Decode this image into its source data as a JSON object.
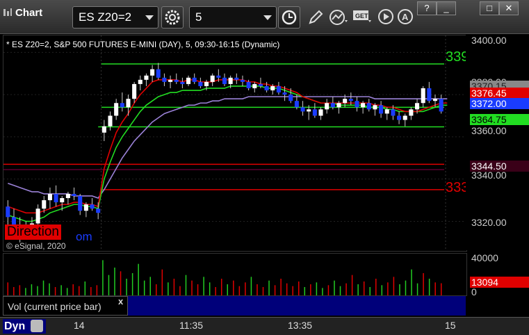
{
  "toolbar": {
    "tab_label": "Chart",
    "symbol_value": "ES Z20=2",
    "interval_value": "5",
    "colors": {
      "bg": "#2d2d2d",
      "accent": "#ffffff"
    }
  },
  "window_buttons": [
    "?",
    "_",
    "□",
    "✕"
  ],
  "chart": {
    "title": "* ES Z20=2, S&P 500 FUTURES E-MINI (DAY), 5, 09:30-16:15 (Dynamic)",
    "direction_label": "Direction",
    "direction_suffix": "om",
    "copyright": "© eSignal, 2020",
    "level_labels": {
      "upper_green": "339",
      "red_line": "333"
    },
    "y_ticks": [
      "3400.00",
      "3380.00",
      "3360.00",
      "3340.00",
      "3320.00"
    ],
    "price_tags": [
      {
        "label": "3370.15",
        "color": "#888888",
        "text_color": "#222"
      },
      {
        "label": "3376.45",
        "color": "#e00000",
        "text_color": "#fff"
      },
      {
        "label": "3372.00",
        "color": "#1a3cff",
        "text_color": "#fff"
      },
      {
        "label": "3364.75",
        "color": "#22dd22",
        "text_color": "#000"
      },
      {
        "label": "3344.50",
        "color": "#3a0018",
        "text_color": "#fff"
      }
    ],
    "x_ticks": [
      "14",
      "11:35",
      "13:35",
      "15"
    ]
  },
  "volume": {
    "y_ticks": [
      "40000",
      "0"
    ],
    "current_tag": "13094",
    "label": "Vol (current price bar)",
    "close_glyph": "x"
  },
  "bottom": {
    "dyn_label": "Dyn"
  },
  "chart_data": {
    "type": "line",
    "ylim": [
      3306,
      3408
    ],
    "hlines": [
      {
        "value": 3394.5,
        "color": "#22dd22"
      },
      {
        "value": 3374.0,
        "color": "#22dd22"
      },
      {
        "value": 3364.75,
        "color": "#22dd22"
      },
      {
        "value": 3347.0,
        "color": "#e00000"
      },
      {
        "value": 3344.5,
        "color": "#5a0030"
      },
      {
        "value": 3335.0,
        "color": "#e00000"
      }
    ],
    "bars": [
      [
        3327,
        3330,
        3316,
        3322
      ],
      [
        3322,
        3326,
        3312,
        3318
      ],
      [
        3318,
        3322,
        3310,
        3314
      ],
      [
        3314,
        3320,
        3312,
        3318
      ],
      [
        3318,
        3322,
        3316,
        3319
      ],
      [
        3319,
        3328,
        3318,
        3326
      ],
      [
        3326,
        3332,
        3324,
        3330
      ],
      [
        3330,
        3336,
        3326,
        3333
      ],
      [
        3333,
        3337,
        3327,
        3329
      ],
      [
        3329,
        3332,
        3325,
        3331
      ],
      [
        3331,
        3334,
        3328,
        3333
      ],
      [
        3333,
        3336,
        3330,
        3332
      ],
      [
        3332,
        3333,
        3323,
        3325
      ],
      [
        3325,
        3329,
        3322,
        3328
      ],
      [
        3328,
        3331,
        3325,
        3326
      ],
      [
        3326,
        3329,
        3321,
        3324
      ],
      [
        3362,
        3368,
        3358,
        3365
      ],
      [
        3365,
        3372,
        3363,
        3370
      ],
      [
        3370,
        3378,
        3368,
        3376
      ],
      [
        3376,
        3381,
        3372,
        3374
      ],
      [
        3374,
        3380,
        3370,
        3378
      ],
      [
        3378,
        3386,
        3376,
        3385
      ],
      [
        3385,
        3389,
        3382,
        3387
      ],
      [
        3387,
        3390,
        3384,
        3389
      ],
      [
        3389,
        3394,
        3386,
        3392
      ],
      [
        3392,
        3395,
        3387,
        3388
      ],
      [
        3388,
        3390,
        3384,
        3386
      ],
      [
        3386,
        3389,
        3383,
        3387
      ],
      [
        3387,
        3390,
        3385,
        3386
      ],
      [
        3386,
        3388,
        3383,
        3385
      ],
      [
        3385,
        3389,
        3384,
        3388
      ],
      [
        3388,
        3390,
        3385,
        3386
      ],
      [
        3386,
        3388,
        3383,
        3384
      ],
      [
        3384,
        3387,
        3382,
        3386
      ],
      [
        3386,
        3390,
        3384,
        3389
      ],
      [
        3389,
        3392,
        3386,
        3388
      ],
      [
        3388,
        3390,
        3384,
        3385
      ],
      [
        3385,
        3389,
        3383,
        3388
      ],
      [
        3388,
        3390,
        3385,
        3387
      ],
      [
        3387,
        3389,
        3384,
        3386
      ],
      [
        3386,
        3387,
        3382,
        3383
      ],
      [
        3383,
        3386,
        3381,
        3385
      ],
      [
        3385,
        3388,
        3383,
        3384
      ],
      [
        3384,
        3386,
        3381,
        3382
      ],
      [
        3382,
        3385,
        3380,
        3384
      ],
      [
        3384,
        3386,
        3380,
        3381
      ],
      [
        3381,
        3384,
        3377,
        3380
      ],
      [
        3380,
        3383,
        3376,
        3377
      ],
      [
        3377,
        3380,
        3373,
        3374
      ],
      [
        3374,
        3377,
        3370,
        3372
      ],
      [
        3372,
        3375,
        3368,
        3373
      ],
      [
        3373,
        3376,
        3369,
        3370
      ],
      [
        3370,
        3374,
        3368,
        3373
      ],
      [
        3373,
        3378,
        3371,
        3376
      ],
      [
        3376,
        3379,
        3373,
        3374
      ],
      [
        3374,
        3377,
        3371,
        3376
      ],
      [
        3376,
        3380,
        3374,
        3378
      ],
      [
        3378,
        3381,
        3375,
        3377
      ],
      [
        3377,
        3379,
        3372,
        3374
      ],
      [
        3374,
        3377,
        3371,
        3376
      ],
      [
        3376,
        3378,
        3372,
        3373
      ],
      [
        3373,
        3376,
        3370,
        3375
      ],
      [
        3375,
        3377,
        3369,
        3371
      ],
      [
        3371,
        3374,
        3368,
        3373
      ],
      [
        3373,
        3375,
        3368,
        3370
      ],
      [
        3370,
        3372,
        3366,
        3368
      ],
      [
        3368,
        3371,
        3365,
        3370
      ],
      [
        3370,
        3374,
        3368,
        3373
      ],
      [
        3373,
        3378,
        3371,
        3376
      ],
      [
        3376,
        3384,
        3374,
        3383
      ],
      [
        3383,
        3386,
        3376,
        3377
      ],
      [
        3377,
        3380,
        3374,
        3378
      ],
      [
        3378,
        3380,
        3371,
        3372
      ]
    ],
    "ma_red": [
      3327,
      3326,
      3325,
      3324,
      3324,
      3324,
      3325,
      3326,
      3327,
      3328,
      3328,
      3329,
      3329,
      3328,
      3328,
      3327,
      3345,
      3354,
      3362,
      3367,
      3371,
      3376,
      3380,
      3383,
      3386,
      3387,
      3387,
      3387,
      3387,
      3386,
      3387,
      3387,
      3386,
      3386,
      3386,
      3387,
      3387,
      3387,
      3387,
      3387,
      3386,
      3386,
      3385,
      3385,
      3384,
      3384,
      3383,
      3382,
      3381,
      3379,
      3378,
      3377,
      3376,
      3376,
      3376,
      3376,
      3376,
      3376,
      3376,
      3376,
      3376,
      3375,
      3375,
      3374,
      3374,
      3373,
      3372,
      3372,
      3372,
      3373,
      3374,
      3375,
      3376,
      3376
    ],
    "ma_green": [
      3323,
      3322,
      3321,
      3320,
      3320,
      3321,
      3322,
      3324,
      3325,
      3326,
      3327,
      3328,
      3328,
      3327,
      3327,
      3326,
      3340,
      3348,
      3355,
      3360,
      3364,
      3368,
      3372,
      3375,
      3377,
      3379,
      3380,
      3381,
      3381,
      3382,
      3382,
      3382,
      3382,
      3383,
      3383,
      3383,
      3383,
      3384,
      3384,
      3384,
      3384,
      3384,
      3384,
      3383,
      3383,
      3383,
      3382,
      3381,
      3380,
      3379,
      3378,
      3377,
      3376,
      3376,
      3376,
      3375,
      3375,
      3375,
      3375,
      3375,
      3374,
      3374,
      3374,
      3373,
      3373,
      3372,
      3372,
      3372,
      3372,
      3372,
      3373,
      3374,
      3375,
      3375
    ],
    "ma_purple": [
      3338,
      3337,
      3336,
      3335,
      3334,
      3334,
      3333,
      3333,
      3333,
      3333,
      3333,
      3332,
      3332,
      3332,
      3332,
      3331,
      3335,
      3340,
      3345,
      3350,
      3354,
      3358,
      3361,
      3364,
      3367,
      3369,
      3371,
      3372,
      3373,
      3374,
      3375,
      3375,
      3376,
      3376,
      3377,
      3377,
      3378,
      3378,
      3378,
      3378,
      3379,
      3379,
      3379,
      3379,
      3379,
      3379,
      3379,
      3379,
      3379,
      3379,
      3379,
      3379,
      3379,
      3379,
      3379,
      3379,
      3379,
      3379,
      3379,
      3379,
      3379,
      3378,
      3378,
      3378,
      3378,
      3378,
      3378,
      3378,
      3378,
      3378,
      3378,
      3378,
      3378,
      3378
    ],
    "volume": [
      14000,
      9000,
      11000,
      8000,
      12000,
      10000,
      16000,
      13000,
      9000,
      11000,
      8000,
      12000,
      10000,
      15000,
      9000,
      11000,
      38000,
      22000,
      30000,
      26000,
      18000,
      24000,
      34000,
      16000,
      20000,
      12000,
      28000,
      14000,
      18000,
      10000,
      22000,
      16000,
      12000,
      20000,
      14000,
      9000,
      18000,
      12000,
      16000,
      10000,
      14000,
      20000,
      12000,
      9000,
      16000,
      11000,
      18000,
      13000,
      10000,
      15000,
      9000,
      12000,
      14000,
      8000,
      11000,
      16000,
      10000,
      13000,
      22000,
      12000,
      15000,
      9000,
      18000,
      11000,
      14000,
      20000,
      12000,
      16000,
      28000,
      13000,
      24000,
      18000,
      14000,
      13094
    ],
    "volume_ylim": [
      0,
      45000
    ]
  }
}
